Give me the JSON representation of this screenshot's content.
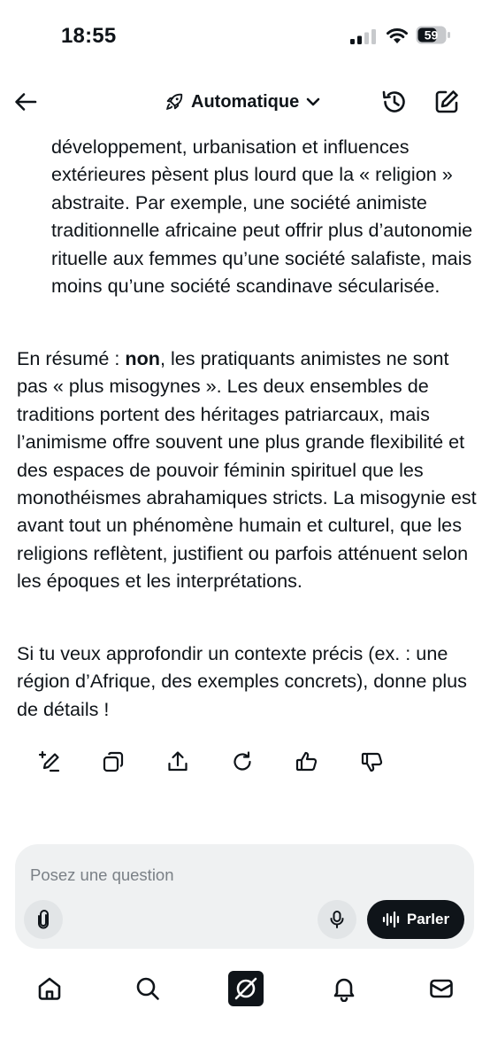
{
  "status_bar": {
    "time": "18:55",
    "battery": "59"
  },
  "header": {
    "mode_label": "Automatique",
    "mode_icon": "rocket-icon"
  },
  "message": {
    "list_item_continuation": "développement, urbanisation et influences extérieures pèsent plus lourd que la « religion » abstraite. Par exemple, une société animiste traditionnelle africaine peut offrir plus d’autonomie rituelle aux femmes qu’une société salafiste, mais moins qu’une société scandinave sécularisée.",
    "summary_prefix": "En résumé : ",
    "summary_bold": "non",
    "summary_rest": ", les pratiquants animistes ne sont pas « plus misogynes ». Les deux ensembles de traditions portent des héritages patriarcaux, mais l’animisme offre souvent une plus grande flexibilité et des espaces de pouvoir féminin spirituel que les monothéismes abrahamiques stricts. La misogynie est avant tout un phénomène humain et culturel, que les religions reflètent, justifient ou parfois atténuent selon les époques et les interprétations.",
    "closing": "Si tu veux approfondir un contexte précis (ex. : une région d’Afrique, des exemples concrets), donne plus de détails !"
  },
  "message_actions": [
    "edit-sparkle-icon",
    "copy-icon",
    "share-icon",
    "regenerate-icon",
    "thumbs-up-icon",
    "thumbs-down-icon"
  ],
  "composer": {
    "placeholder": "Posez une question",
    "talk_label": "Parler"
  },
  "bottom_nav": [
    "home-icon",
    "search-icon",
    "grok-icon",
    "notifications-icon",
    "messages-icon"
  ],
  "colors": {
    "text": "#0f1419",
    "composer_bg": "#eff1f2",
    "talk_button": "#0f1419"
  }
}
